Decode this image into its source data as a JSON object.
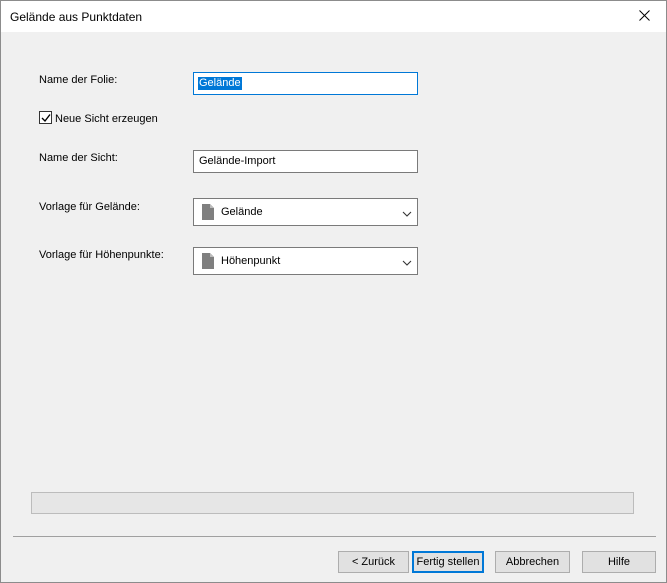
{
  "window": {
    "title": "Gelände aus Punktdaten"
  },
  "form": {
    "layer_name_label": "Name der Folie:",
    "layer_name_value": "Gelände",
    "create_view_label": "Neue Sicht erzeugen",
    "create_view_checked": true,
    "view_name_label": "Name der Sicht:",
    "view_name_value": "Gelände-Import",
    "terrain_template_label": "Vorlage für Gelände:",
    "terrain_template_value": "Gelände",
    "height_points_template_label": "Vorlage für Höhenpunkte:",
    "height_points_template_value": "Höhenpunkt"
  },
  "progress": {
    "value": 0
  },
  "buttons": {
    "back": "< Zurück",
    "finish": "Fertig stellen",
    "cancel": "Abbrechen",
    "help": "Hilfe"
  },
  "colors": {
    "accent": "#0078d7",
    "background": "#f0f0f0"
  },
  "icons": {
    "close": "close-icon",
    "check": "checkmark-icon",
    "document": "document-icon",
    "dropdown": "chevron-down-icon"
  }
}
